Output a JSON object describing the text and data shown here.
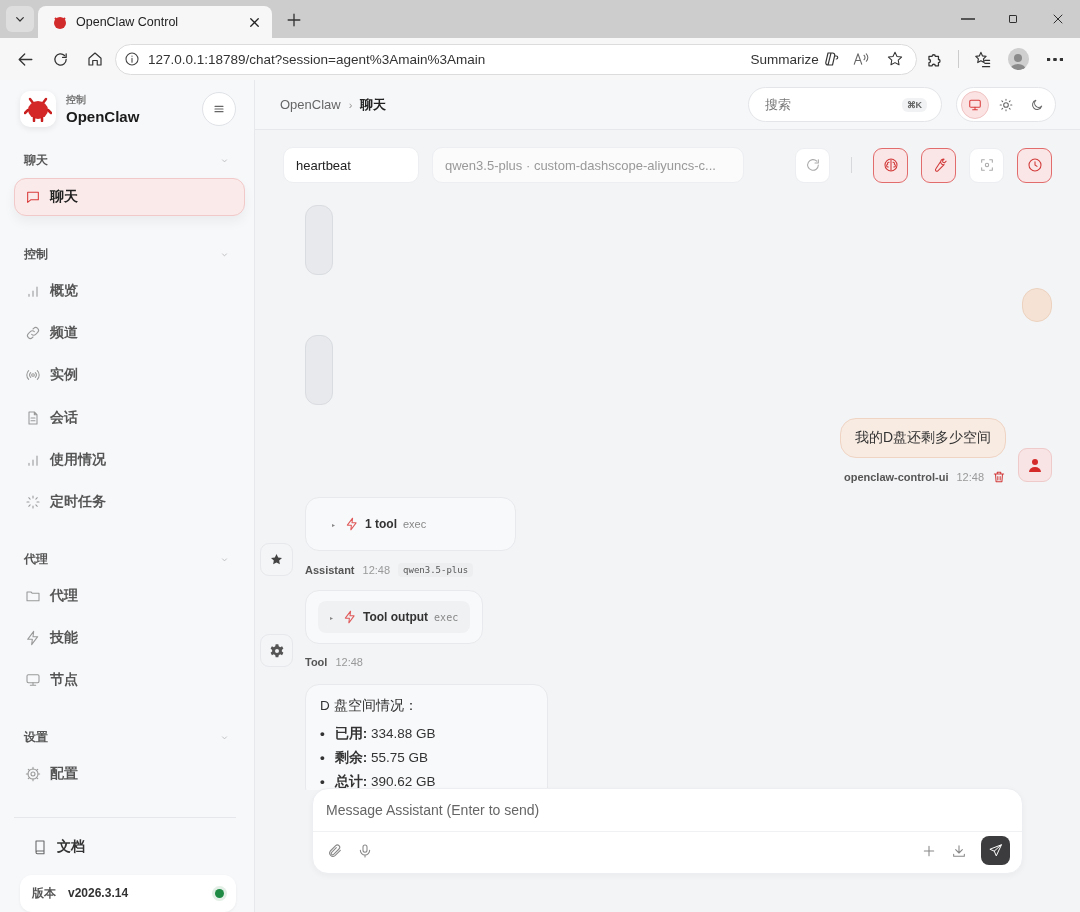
{
  "browser": {
    "tab_title": "OpenClaw Control",
    "url": "127.0.0.1:18789/chat?session=agent%3Amain%3Amain",
    "summarize_label": "Summarize"
  },
  "sidebar": {
    "brand_caption": "控制",
    "brand_name": "OpenClaw",
    "sections": [
      {
        "title": "聊天",
        "expanded": true,
        "items": [
          {
            "kind": "chat",
            "label": "聊天",
            "selected": true
          }
        ]
      },
      {
        "title": "控制",
        "expanded": true,
        "items": [
          {
            "kind": "bars",
            "label": "概览",
            "selected": false
          },
          {
            "kind": "link",
            "label": "频道",
            "selected": false
          },
          {
            "kind": "radio",
            "label": "实例",
            "selected": false
          },
          {
            "kind": "doc",
            "label": "会话",
            "selected": false
          },
          {
            "kind": "bars",
            "label": "使用情况",
            "selected": false
          },
          {
            "kind": "spinner",
            "label": "定时任务",
            "selected": false
          }
        ]
      },
      {
        "title": "代理",
        "expanded": true,
        "items": [
          {
            "kind": "folder",
            "label": "代理",
            "selected": false
          },
          {
            "kind": "bolt",
            "label": "技能",
            "selected": false
          },
          {
            "kind": "monitor",
            "label": "节点",
            "selected": false
          }
        ]
      },
      {
        "title": "设置",
        "expanded": true,
        "items": [
          {
            "kind": "gear",
            "label": "配置",
            "selected": false
          }
        ]
      }
    ],
    "docs_label": "文档",
    "version_label": "版本",
    "version": "v2026.3.14",
    "connected": true
  },
  "header": {
    "breadcrumb": [
      "OpenClaw",
      "聊天"
    ],
    "breadcrumb_separator": "›",
    "search_placeholder": "搜索",
    "shortcut": "⌘K",
    "theme_modes": [
      {
        "kind": "monitor",
        "selected": true
      },
      {
        "kind": "sun",
        "selected": false
      },
      {
        "kind": "moon",
        "selected": false
      }
    ]
  },
  "toolbar": {
    "session": "heartbeat",
    "model": "qwen3.5-plus · custom-dashscope-aliyuncs-c...",
    "actions": [
      {
        "kind": "refresh",
        "on": false
      },
      {
        "kind": "brain",
        "on": true
      },
      {
        "kind": "wrench",
        "on": true
      },
      {
        "kind": "focus",
        "on": false
      },
      {
        "kind": "clock",
        "on": true
      }
    ]
  },
  "messages": [
    {
      "kind": "empty_left"
    },
    {
      "kind": "empty_right"
    },
    {
      "kind": "empty_left"
    },
    {
      "kind": "user",
      "text": "我的D盘还剩多少空间",
      "sender": "openclaw-control-ui",
      "time": "12:48"
    },
    {
      "kind": "tool_summary",
      "marker": "▸",
      "summary": "1 tool",
      "tool": "exec",
      "sender": "Assistant",
      "time": "12:48",
      "model": "qwen3.5-plus"
    },
    {
      "kind": "tool_output",
      "marker": "▸",
      "label": "Tool output",
      "tool": "exec",
      "sender": "Tool",
      "time": "12:48"
    },
    {
      "kind": "text",
      "heading": "D 盘空间情况：",
      "bullets": [
        {
          "marker": "•",
          "text": "**已用:** 334.88 GB"
        },
        {
          "marker": "•",
          "text": "**剩余:** 55.75 GB"
        },
        {
          "marker": "•",
          "text": "**总计:** 390.62 GB"
        }
      ]
    }
  ],
  "composer": {
    "placeholder": "Message Assistant (Enter to send)"
  }
}
